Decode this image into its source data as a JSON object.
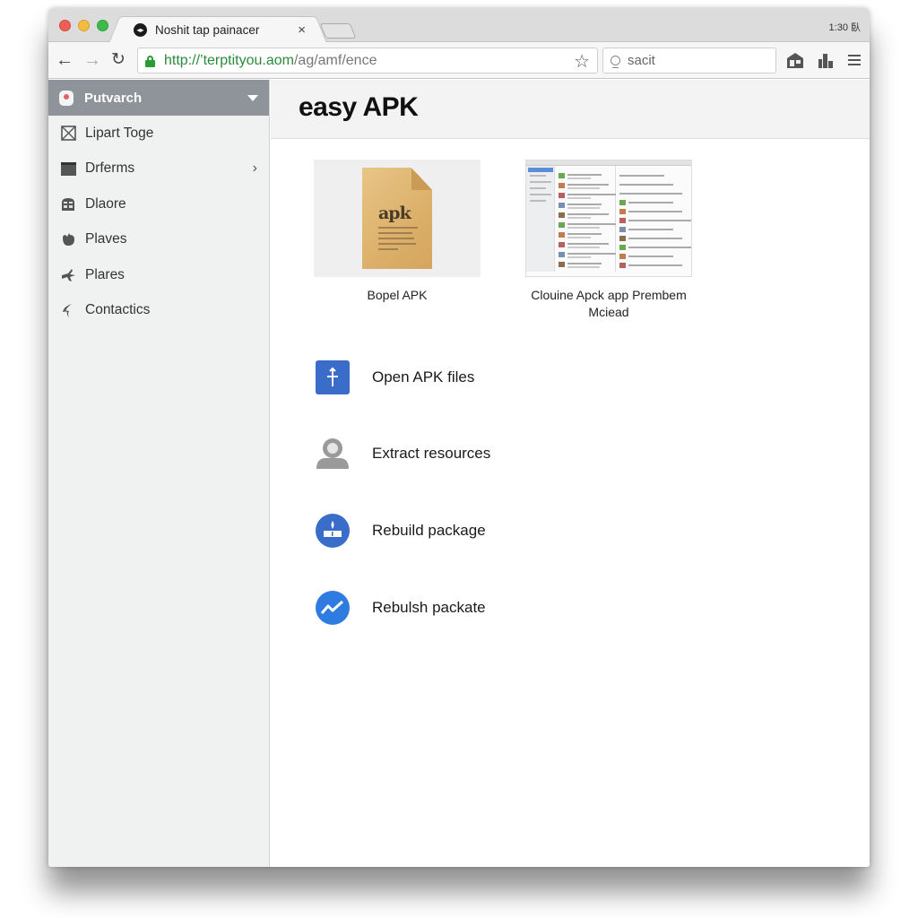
{
  "window": {
    "tab": {
      "title": "Noshit tap painacer",
      "favicon": "media-icon",
      "close": "×"
    },
    "status_text": "1:30 臥"
  },
  "toolbar": {
    "back": "←",
    "forward": "→",
    "reload": "↻",
    "url": {
      "host": "http://’terptityou.aom",
      "path": "/ag/amf/ence"
    },
    "bookmark": "☆",
    "search": {
      "value": "sacit",
      "icon": "search-icon"
    },
    "icons": [
      "home-icon",
      "stats-icon",
      "menu-icon"
    ]
  },
  "sidebar": {
    "header": {
      "label": "Putvarch",
      "icon": "profile-icon"
    },
    "items": [
      {
        "label": "Lipart Toge",
        "icon": "box-x-icon",
        "has_chevron": false
      },
      {
        "label": "Drferms",
        "icon": "folder-icon",
        "has_chevron": true,
        "chevron": "›"
      },
      {
        "label": "Dlaore",
        "icon": "building-icon",
        "has_chevron": false
      },
      {
        "label": "Plaves",
        "icon": "apple-icon",
        "has_chevron": false
      },
      {
        "label": "Plares",
        "icon": "plane-icon",
        "has_chevron": false
      },
      {
        "label": "Contactics",
        "icon": "contact-icon",
        "has_chevron": false
      }
    ]
  },
  "main": {
    "title": "easy APK",
    "cards": [
      {
        "caption": "Bopel APK",
        "thumb_text": "apk"
      },
      {
        "caption": "Clouine Apck app Prembem Mciead"
      }
    ],
    "actions": [
      {
        "label": "Open APK files",
        "icon": "upload-icon",
        "color": "#3a6cc9"
      },
      {
        "label": "Extract resources",
        "icon": "user-icon",
        "color": "#9a9a9a"
      },
      {
        "label": "Rebuild package",
        "icon": "build-icon",
        "color": "#3a6cc9"
      },
      {
        "label": "Rebulsh packate",
        "icon": "trend-icon",
        "color": "#2f7ce0"
      }
    ]
  }
}
